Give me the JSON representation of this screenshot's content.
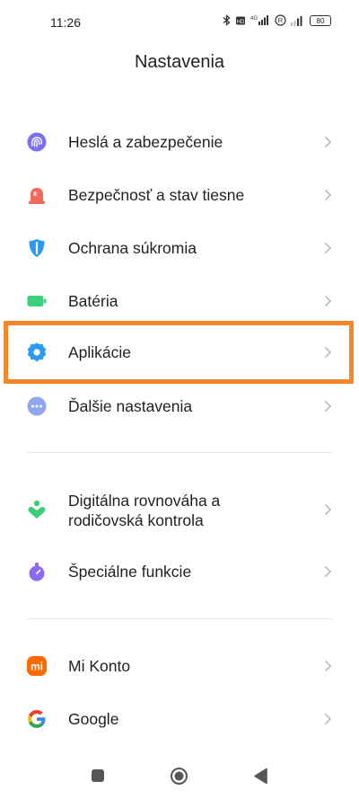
{
  "status_bar": {
    "time": "11:26",
    "battery": "80",
    "network": "4G",
    "icons": [
      "bluetooth-icon",
      "sim-icon",
      "signal-icon",
      "roaming-icon",
      "signal-icon-2",
      "battery-icon"
    ]
  },
  "header": {
    "title": "Nastavenia"
  },
  "sections": [
    {
      "items": [
        {
          "label": "Heslá a zabezpečenie",
          "icon": "fingerprint-icon",
          "color": "#7a6ff0"
        },
        {
          "label": "Bezpečnosť a stav tiesne",
          "icon": "alarm-light-icon",
          "color": "#f26a5a"
        },
        {
          "label": "Ochrana súkromia",
          "icon": "privacy-shield-icon",
          "color": "#2b9bf0"
        },
        {
          "label": "Batéria",
          "icon": "battery-status-icon",
          "color": "#3ad17d"
        },
        {
          "label": "Aplikácie",
          "icon": "gear-icon",
          "color": "#2b9bf0"
        },
        {
          "label": "Ďalšie nastavenia",
          "icon": "more-dots-icon",
          "color": "#8ea6f0"
        }
      ]
    },
    {
      "items": [
        {
          "label_line1": "Digitálna rovnováha a",
          "label_line2": "rodičovská kontrola",
          "icon": "digital-wellbeing-icon",
          "color": "#3ccf7a"
        },
        {
          "label": "Špeciálne funkcie",
          "icon": "special-features-icon",
          "color": "#8b6cf0"
        }
      ]
    },
    {
      "items": [
        {
          "label": "Mi Konto",
          "icon": "mi-logo-icon",
          "color": "#ff6900",
          "logo_text": "mi"
        },
        {
          "label": "Google",
          "icon": "google-logo-icon",
          "colors": [
            "#4285F4",
            "#EA4335",
            "#FBBC05",
            "#34A853"
          ]
        }
      ]
    }
  ],
  "highlight_color": "#f5882a",
  "nav_bar": {
    "icons": [
      "recents-square-icon",
      "home-circle-icon",
      "back-triangle-icon"
    ]
  }
}
